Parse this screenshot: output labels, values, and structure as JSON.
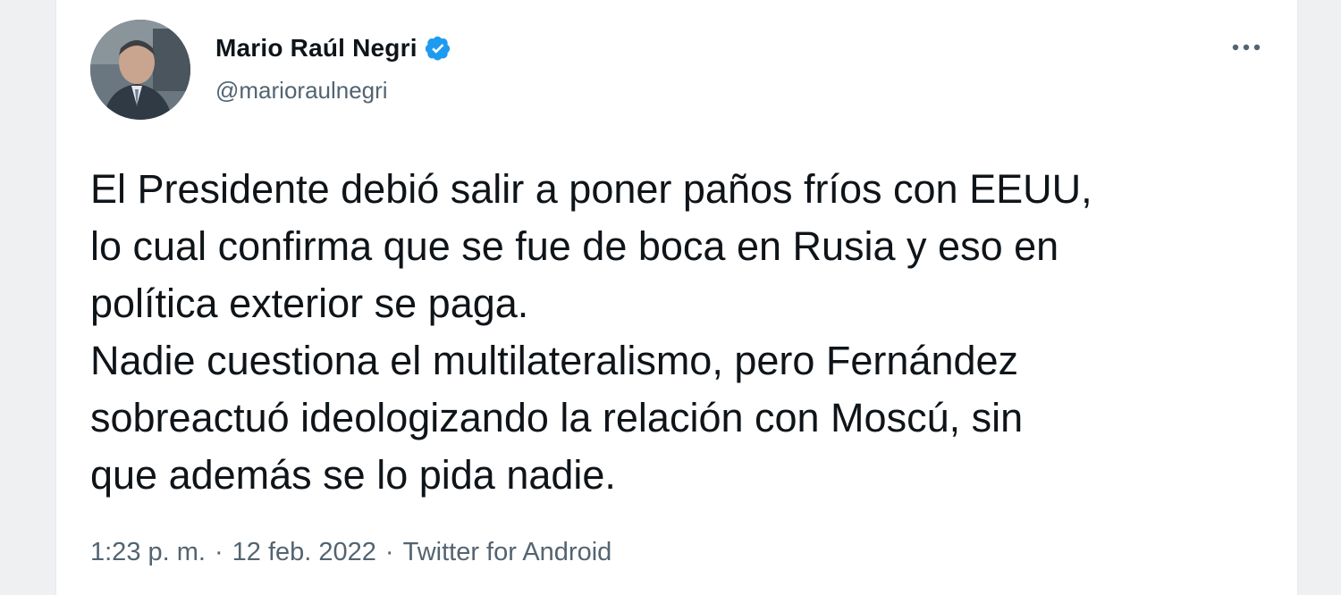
{
  "tweet": {
    "author": {
      "display_name": "Mario Raúl Negri",
      "handle": "@marioraulnegri",
      "verified": true
    },
    "text": "El Presidente debió salir a poner paños fríos con EEUU,\nlo cual confirma que se fue de boca en Rusia y eso en\npolítica exterior se paga.\nNadie cuestiona el multilateralismo, pero Fernández\nsobreactuó ideologizando la relación con Moscú, sin\nque además se lo pida nadie.",
    "time": "1:23 p. m.",
    "separator": "·",
    "date": "12 feb. 2022",
    "source": "Twitter for Android"
  },
  "icons": {
    "verified": "verified-badge-icon",
    "more": "more-horizontal-icon"
  },
  "colors": {
    "text_primary": "#0f1419",
    "text_secondary": "#536471",
    "verified_blue": "#1d9bf0",
    "background": "#ffffff"
  }
}
